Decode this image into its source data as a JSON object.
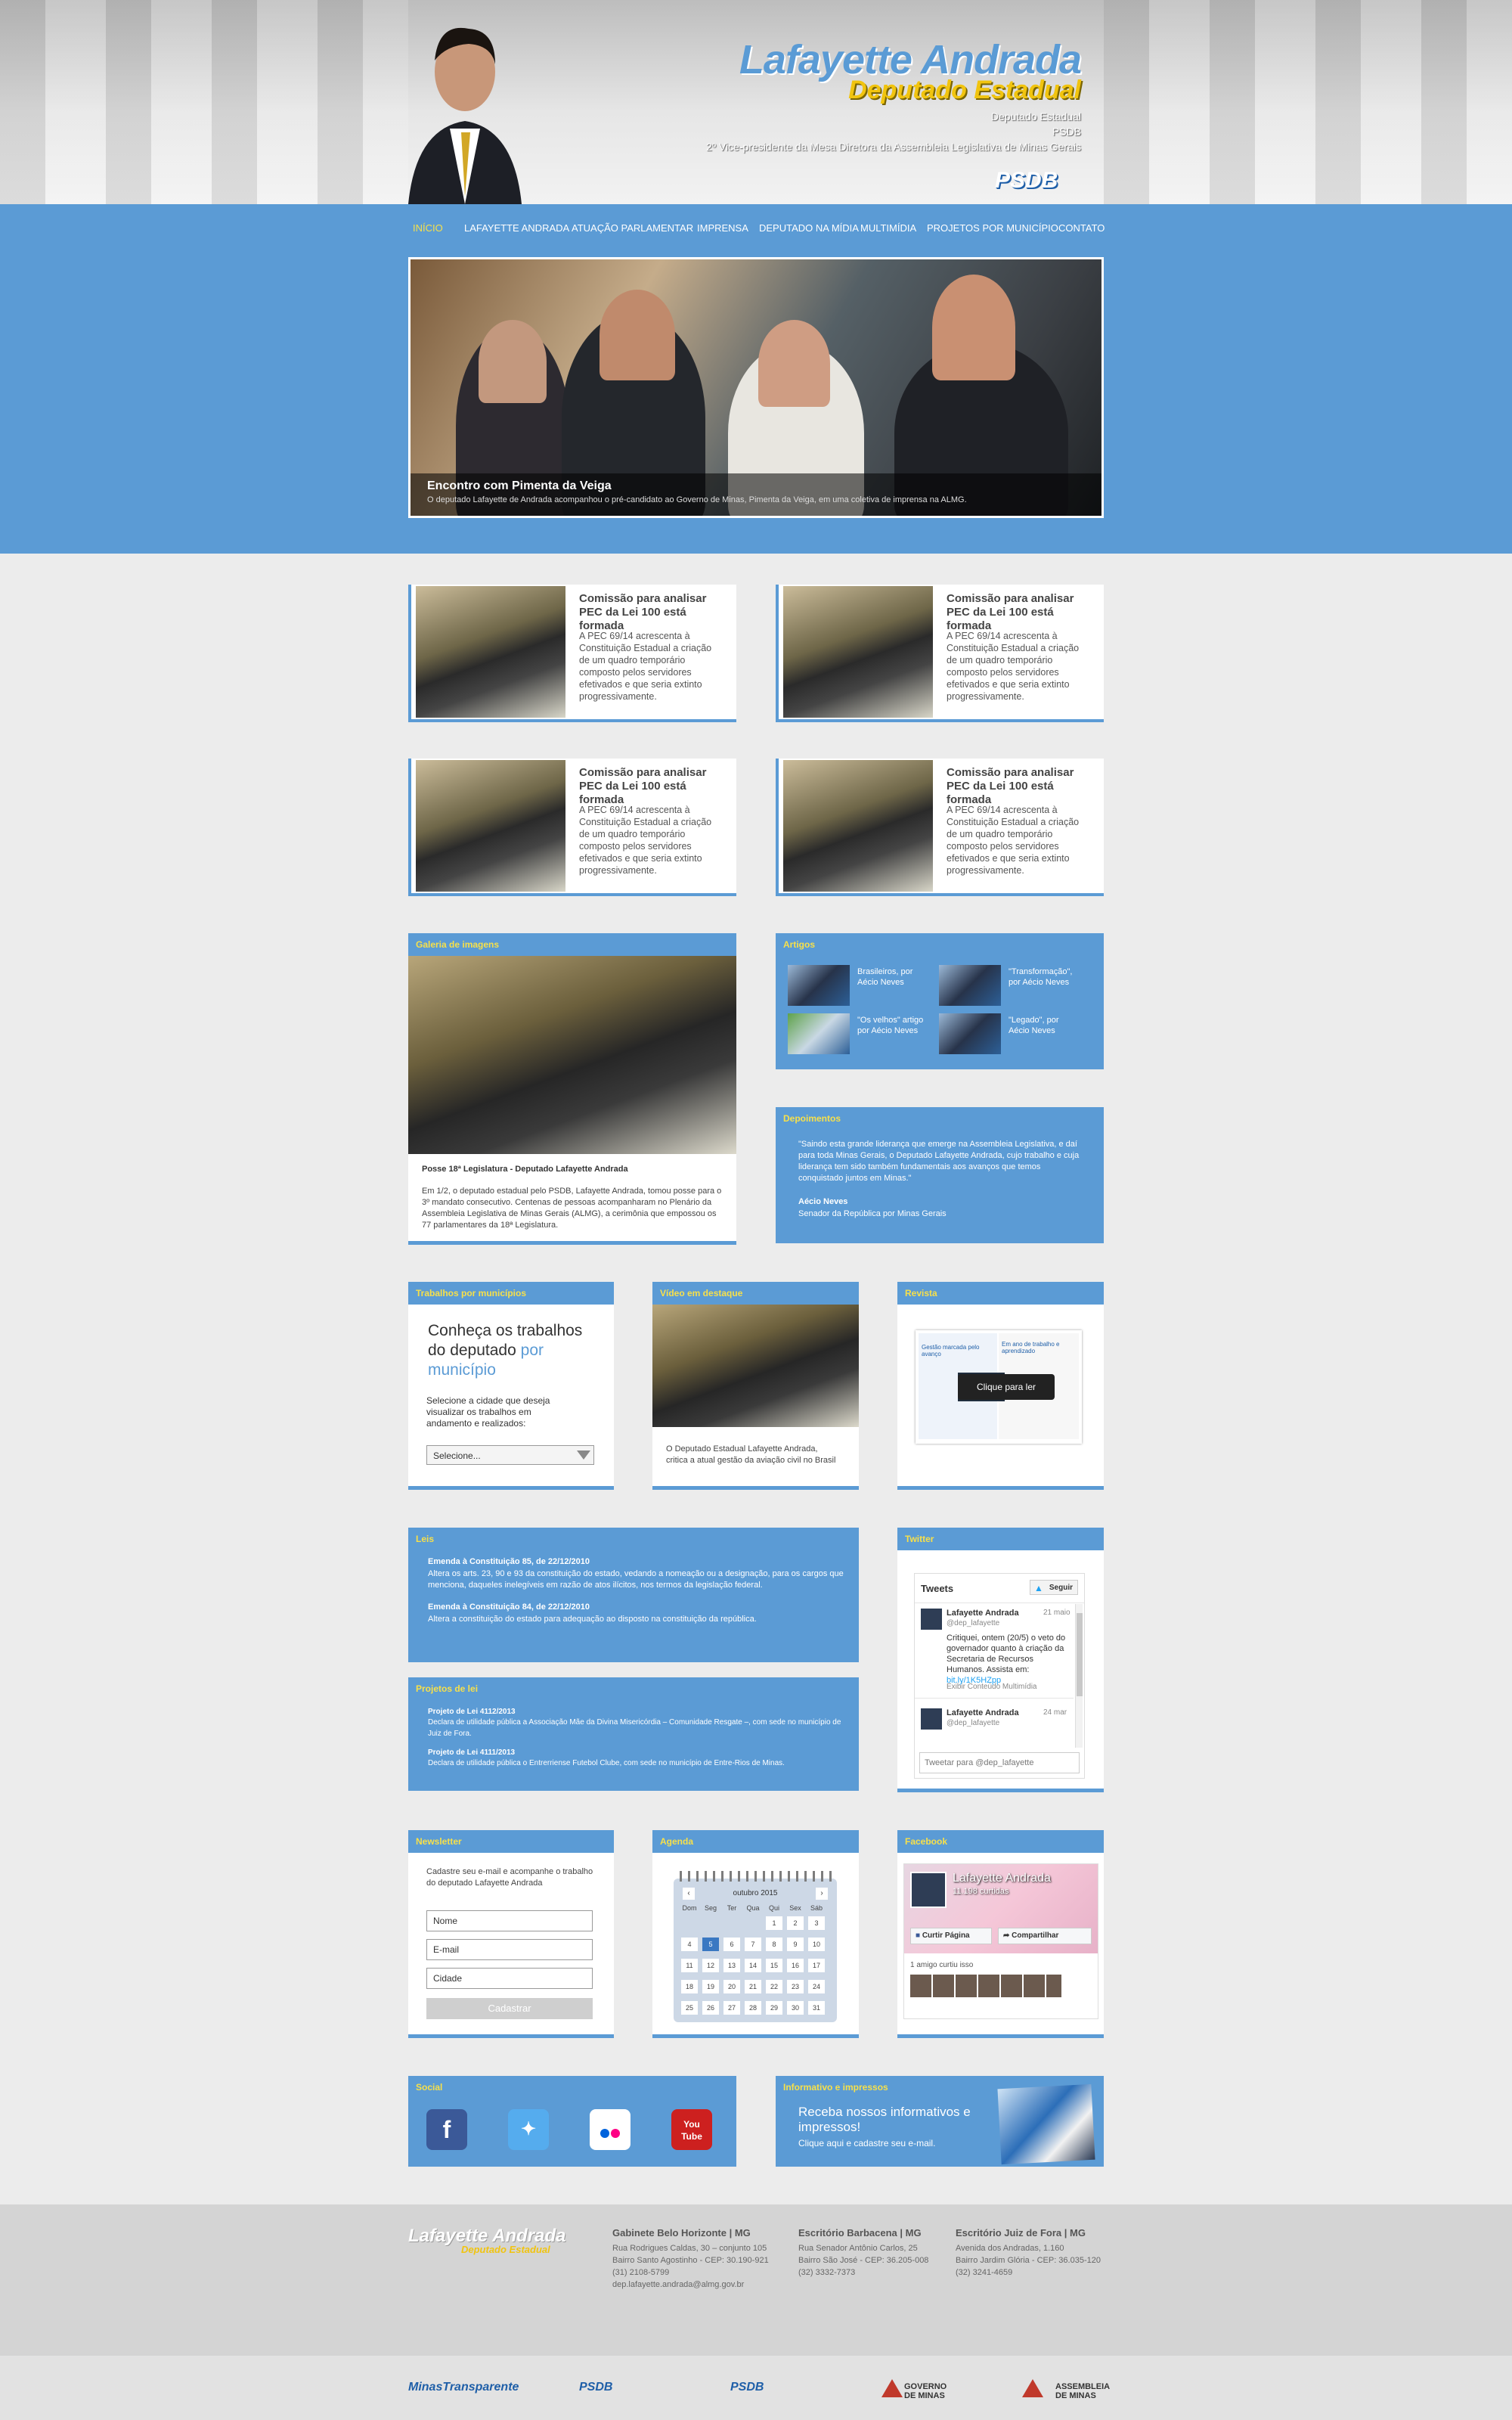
{
  "header": {
    "title": "Lafayette Andrada",
    "subtitle": "Deputado Estadual",
    "lines": [
      "Deputado Estadual",
      "PSDB",
      "2º Vice-presidente da Mesa Diretora da Assembleia Legislativa de Minas Gerais"
    ],
    "party_logo": "PSDB"
  },
  "nav": [
    "INÍCIO",
    "LAFAYETTE ANDRADA",
    "ATUAÇÃO PARLAMENTAR",
    "IMPRENSA",
    "DEPUTADO NA MÍDIA",
    "MULTIMÍDIA",
    "PROJETOS POR MUNICÍPIO",
    "CONTATO"
  ],
  "hero": {
    "title": "Encontro com Pimenta da Veiga",
    "text": "O deputado Lafayette de Andrada acompanhou o pré-candidato ao Governo de Minas, Pimenta da Veiga, em uma coletiva de imprensa na ALMG."
  },
  "news": [
    {
      "title": "Comissão para analisar PEC da Lei 100 está formada",
      "text": "A PEC 69/14 acrescenta à Constituição Estadual a criação de um quadro temporário composto pelos servidores efetivados e que seria extinto progressivamente."
    },
    {
      "title": "Comissão para analisar PEC da Lei 100 está formada",
      "text": "A PEC 69/14 acrescenta à Constituição Estadual a criação de um quadro temporário composto pelos servidores efetivados e que seria extinto progressivamente."
    },
    {
      "title": "Comissão para analisar PEC da Lei 100 está formada",
      "text": "A PEC 69/14 acrescenta à Constituição Estadual a criação de um quadro temporário composto pelos servidores efetivados e que seria extinto progressivamente."
    },
    {
      "title": "Comissão para analisar PEC da Lei 100 está formada",
      "text": "A PEC 69/14 acrescenta à Constituição Estadual a criação de um quadro temporário composto pelos servidores efetivados e que seria extinto progressivamente."
    }
  ],
  "gallery": {
    "heading": "Galeria de imagens",
    "caption": "Posse 18ª Legislatura - Deputado Lafayette Andrada",
    "text": "Em 1/2, o deputado estadual pelo PSDB, Lafayette Andrada, tomou posse para o 3º mandato consecutivo. Centenas de pessoas acompanharam no Plenário da Assembleia Legislativa de Minas Gerais (ALMG), a cerimônia que empossou os 77 parlamentares da 18ª Legislatura."
  },
  "artigos": {
    "heading": "Artigos",
    "items": [
      "Brasileiros, por Aécio Neves",
      "\"Transformação\", por Aécio Neves",
      "\"Os velhos\" artigo por Aécio Neves",
      "\"Legado\", por Aécio Neves"
    ]
  },
  "depoimentos": {
    "heading": "Depoimentos",
    "quote": "\"Saindo esta grande liderança que emerge na Assembleia Legislativa, e daí para toda Minas Gerais, o Deputado Lafayette Andrada, cujo trabalho e cuja liderança tem sido também fundamentais aos avanços que temos conquistado juntos em Minas.\"",
    "author": "Aécio Neves",
    "role": "Senador da República por Minas Gerais"
  },
  "municipios": {
    "heading": "Trabalhos por municípios",
    "title_part1": "Conheça os trabalhos do deputado",
    "title_part2": "por município",
    "text": "Selecione a cidade que deseja visualizar os trabalhos em andamento e realizados:",
    "select": "Selecione..."
  },
  "video": {
    "heading": "Vídeo em destaque",
    "text": "O Deputado Estadual Lafayette Andrada, critica a atual gestão da aviação civil no Brasil"
  },
  "revista": {
    "heading": "Revista",
    "button": "Clique para ler",
    "page1": "Gestão marcada pelo avanço",
    "page2": "Em ano de trabalho e aprendizado"
  },
  "leis": {
    "heading": "Leis",
    "items": [
      {
        "title": "Emenda à Constituição 85, de 22/12/2010",
        "text": "Altera os arts. 23, 90 e 93 da constituição do estado, vedando a nomeação ou a designação, para os cargos que menciona, daqueles inelegíveis em razão de atos ilícitos, nos termos da legislação federal."
      },
      {
        "title": "Emenda à Constituição 84, de 22/12/2010",
        "text": "Altera a constituição do estado para adequação ao disposto na constituição da república."
      }
    ]
  },
  "projetos": {
    "heading": "Projetos de lei",
    "items": [
      {
        "title": "Projeto de Lei 4112/2013",
        "text": "Declara de utilidade pública a Associação Mãe da Divina Misericórdia – Comunidade Resgate –, com sede no município de Juiz de Fora."
      },
      {
        "title": "Projeto de Lei 4111/2013",
        "text": "Declara de utilidade pública o Entrerriense Futebol Clube, com sede no município de Entre-Rios de Minas."
      }
    ]
  },
  "twitter": {
    "heading": "Twitter",
    "title": "Tweets",
    "follow": "Seguir",
    "tweet1": {
      "name": "Lafayette Andrada",
      "handle": "@dep_lafayette",
      "date": "21 maio",
      "text": "Critiquei, ontem (20/5) o veto do governador quanto à criação da Secretaria de Recursos Humanos. Assista em:",
      "link": "bit.ly/1K5HZpp",
      "media": "Exibir Conteúdo Multimídia"
    },
    "tweet2": {
      "name": "Lafayette Andrada",
      "handle": "@dep_lafayette",
      "date": "24 mar"
    },
    "placeholder": "Tweetar para @dep_lafayette"
  },
  "newsletter": {
    "heading": "Newsletter",
    "text": "Cadastre seu e-mail e acompanhe o trabalho do deputado Lafayette Andrada",
    "fields": [
      "Nome",
      "E-mail",
      "Cidade"
    ],
    "button": "Cadastrar"
  },
  "agenda": {
    "heading": "Agenda",
    "month": "outubro 2015",
    "days": [
      "Dom",
      "Seg",
      "Ter",
      "Qua",
      "Qui",
      "Sex",
      "Sáb"
    ],
    "dates": [
      "",
      "",
      "",
      "",
      "1",
      "2",
      "3",
      "4",
      "5",
      "6",
      "7",
      "8",
      "9",
      "10",
      "11",
      "12",
      "13",
      "14",
      "15",
      "16",
      "17",
      "18",
      "19",
      "20",
      "21",
      "22",
      "23",
      "24",
      "25",
      "26",
      "27",
      "28",
      "29",
      "30",
      "31"
    ],
    "selected": "5"
  },
  "facebook": {
    "heading": "Facebook",
    "page_name": "Lafayette Andrada",
    "likes": "11.198 curtidas",
    "like_btn": "Curtir Página",
    "share_btn": "Compartilhar",
    "friends": "1 amigo curtiu isso"
  },
  "social": {
    "heading": "Social"
  },
  "informativo": {
    "heading": "Informativo e impressos",
    "title": "Receba nossos informativos e impressos!",
    "text": "Clique aqui e cadastre seu e-mail."
  },
  "footer": {
    "logo_title": "Lafayette Andrada",
    "logo_subtitle": "Deputado Estadual",
    "offices": [
      {
        "title": "Gabinete Belo Horizonte | MG",
        "lines": [
          "Rua Rodrigues Caldas, 30 – conjunto 105",
          "Bairro Santo Agostinho - CEP: 30.190-921",
          "(31) 2108-5799",
          "dep.lafayette.andrada@almg.gov.br"
        ]
      },
      {
        "title": "Escritório Barbacena | MG",
        "lines": [
          "Rua Senador Antônio Carlos, 25",
          "Bairro São José - CEP: 36.205-008",
          "(32) 3332-7373"
        ]
      },
      {
        "title": "Escritório Juiz de Fora | MG",
        "lines": [
          "Avenida dos Andradas, 1.160",
          "Bairro Jardim Glória - CEP: 36.035-120",
          "(32) 3241-4659"
        ]
      }
    ],
    "partners": [
      "MinasTransparente",
      "PSDB",
      "PSDB",
      "GOVERNO DE MINAS",
      "ASSEMBLEIA DE MINAS"
    ]
  },
  "colors": {
    "blue": "#5b9bd5",
    "yellow": "#f7e04a"
  }
}
